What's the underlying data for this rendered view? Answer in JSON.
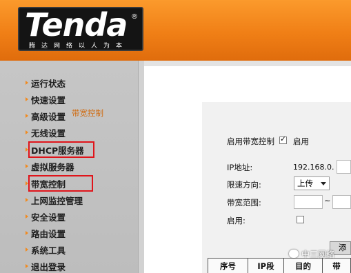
{
  "brand": {
    "logo": "Tenda",
    "registered": "®",
    "slogan": "腾达网络以人为本"
  },
  "sidebar": {
    "items": [
      {
        "label": "运行状态"
      },
      {
        "label": "快速设置"
      },
      {
        "label": "高级设置"
      },
      {
        "label": "无线设置"
      },
      {
        "label": "DHCP服务器",
        "highlighted": true
      },
      {
        "label": "虚拟服务器"
      },
      {
        "label": "带宽控制",
        "highlighted": true
      },
      {
        "label": "上网监控管理"
      },
      {
        "label": "安全设置"
      },
      {
        "label": "路由设置"
      },
      {
        "label": "系统工具"
      },
      {
        "label": "退出登录"
      }
    ],
    "highlight_color": "#e0141a"
  },
  "main": {
    "section_title": "带宽控制",
    "enable_bw": {
      "label": "启用带宽控制",
      "checked": true,
      "after": "启用"
    },
    "ip": {
      "label": "IP地址:",
      "value": "192.168.0."
    },
    "direction": {
      "label": "限速方向:",
      "value": "上传"
    },
    "range": {
      "label": "带宽范围:",
      "separator": "~"
    },
    "enable": {
      "label": "启用:",
      "checked": false
    },
    "add_button": "添",
    "table_headers": [
      "序号",
      "IP段",
      "目的",
      "带"
    ]
  },
  "watermark": "中三网络",
  "colors": {
    "header": "#f07f16",
    "accent": "#d06b10"
  }
}
